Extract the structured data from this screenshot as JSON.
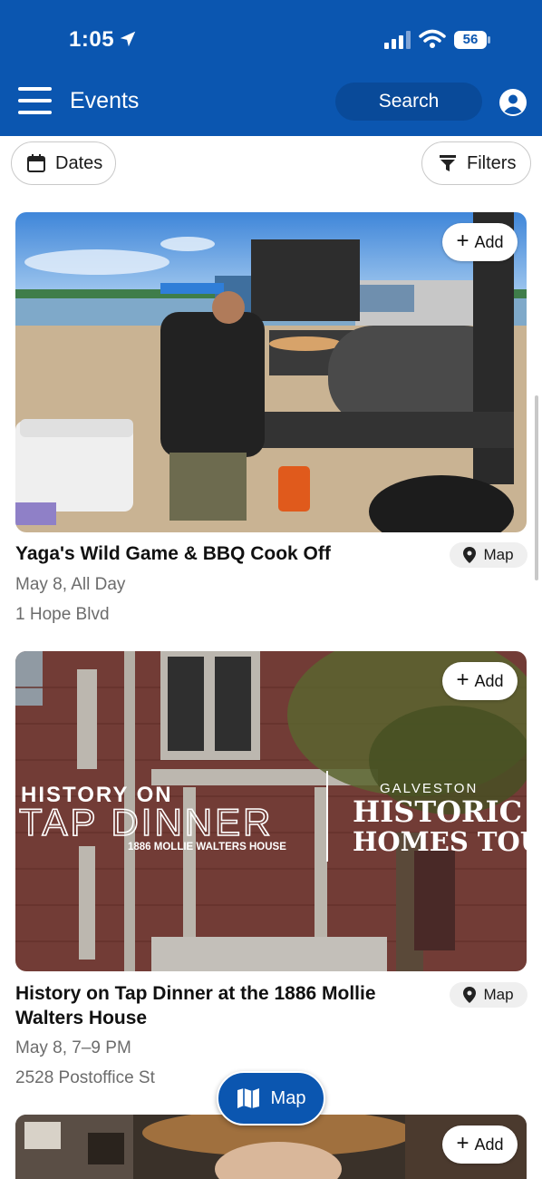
{
  "status_bar": {
    "time": "1:05",
    "battery": "56"
  },
  "header": {
    "title": "Events",
    "search_label": "Search"
  },
  "filters": {
    "dates_label": "Dates",
    "filters_label": "Filters"
  },
  "events": [
    {
      "title": "Yaga's Wild Game & BBQ Cook Off",
      "date": "May 8, All Day",
      "address": "1 Hope Blvd",
      "add_label": "Add",
      "map_label": "Map"
    },
    {
      "title": "History on Tap Dinner at the 1886 Mollie Walters House",
      "date": "May 8, 7–9 PM",
      "address": "2528 Postoffice St",
      "add_label": "Add",
      "map_label": "Map",
      "image_text": {
        "left_line1": "HISTORY ON",
        "left_line2": "TAP DINNER",
        "left_line3": "1886 MOLLIE WALTERS HOUSE",
        "right_line1": "GALVESTON",
        "right_line2": "HISTORIC",
        "right_line3": "HOMES TOUR"
      }
    },
    {
      "add_label": "Add"
    }
  ],
  "fab": {
    "label": "Map"
  },
  "colors": {
    "brand_blue": "#0b56b0",
    "search_bg": "#094a99",
    "muted_text": "#6c6c6c"
  }
}
